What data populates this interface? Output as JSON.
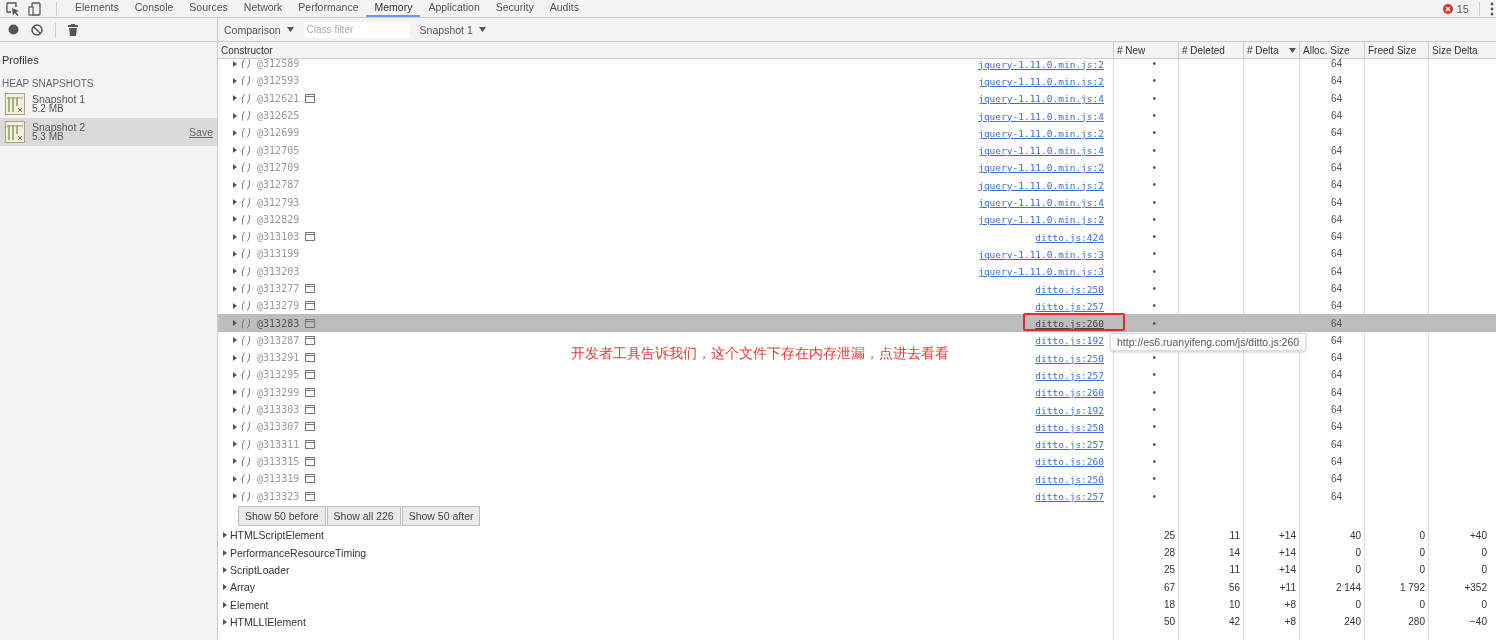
{
  "tabs": [
    {
      "label": "Elements",
      "selected": false
    },
    {
      "label": "Console",
      "selected": false
    },
    {
      "label": "Sources",
      "selected": false
    },
    {
      "label": "Network",
      "selected": false
    },
    {
      "label": "Performance",
      "selected": false
    },
    {
      "label": "Memory",
      "selected": true
    },
    {
      "label": "Application",
      "selected": false
    },
    {
      "label": "Security",
      "selected": false
    },
    {
      "label": "Audits",
      "selected": false
    }
  ],
  "error_count": "15",
  "toolbar": {
    "view": "Comparison",
    "filter_placeholder": "Class filter",
    "baseline": "Snapshot 1"
  },
  "sidebar": {
    "title": "Profiles",
    "section": "HEAP SNAPSHOTS",
    "snapshots": [
      {
        "name": "Snapshot 1",
        "size": "5.2 MB",
        "selected": false
      },
      {
        "name": "Snapshot 2",
        "size": "5.3 MB",
        "selected": true,
        "action": "Save"
      }
    ]
  },
  "table": {
    "columns": [
      {
        "label": "Constructor",
        "sorted": false
      },
      {
        "label": "# New",
        "sorted": false
      },
      {
        "label": "# Deleted",
        "sorted": false
      },
      {
        "label": "# Delta",
        "sorted": true
      },
      {
        "label": "Alloc. Size",
        "sorted": false
      },
      {
        "label": "Freed Size",
        "sorted": false
      },
      {
        "label": "Size Delta",
        "sorted": false
      }
    ],
    "instances": [
      {
        "name": "()",
        "id": "@312589",
        "window_icon": false,
        "source": "jquery-1.11.0.min.js:2",
        "new": "•",
        "alloc": "64",
        "selected": false,
        "boxed": false
      },
      {
        "name": "()",
        "id": "@312593",
        "window_icon": false,
        "source": "jquery-1.11.0.min.js:2",
        "new": "•",
        "alloc": "64",
        "selected": false,
        "boxed": false
      },
      {
        "name": "()",
        "id": "@312621",
        "window_icon": true,
        "source": "jquery-1.11.0.min.js:4",
        "new": "•",
        "alloc": "64",
        "selected": false,
        "boxed": false
      },
      {
        "name": "()",
        "id": "@312625",
        "window_icon": false,
        "source": "jquery-1.11.0.min.js:4",
        "new": "•",
        "alloc": "64",
        "selected": false,
        "boxed": false
      },
      {
        "name": "()",
        "id": "@312699",
        "window_icon": false,
        "source": "jquery-1.11.0.min.js:2",
        "new": "•",
        "alloc": "64",
        "selected": false,
        "boxed": false
      },
      {
        "name": "()",
        "id": "@312705",
        "window_icon": false,
        "source": "jquery-1.11.0.min.js:4",
        "new": "•",
        "alloc": "64",
        "selected": false,
        "boxed": false
      },
      {
        "name": "()",
        "id": "@312709",
        "window_icon": false,
        "source": "jquery-1.11.0.min.js:2",
        "new": "•",
        "alloc": "64",
        "selected": false,
        "boxed": false
      },
      {
        "name": "()",
        "id": "@312787",
        "window_icon": false,
        "source": "jquery-1.11.0.min.js:2",
        "new": "•",
        "alloc": "64",
        "selected": false,
        "boxed": false
      },
      {
        "name": "()",
        "id": "@312793",
        "window_icon": false,
        "source": "jquery-1.11.0.min.js:4",
        "new": "•",
        "alloc": "64",
        "selected": false,
        "boxed": false
      },
      {
        "name": "()",
        "id": "@312829",
        "window_icon": false,
        "source": "jquery-1.11.0.min.js:2",
        "new": "•",
        "alloc": "64",
        "selected": false,
        "boxed": false
      },
      {
        "name": "()",
        "id": "@313103",
        "window_icon": true,
        "source": "ditto.js:424",
        "new": "•",
        "alloc": "64",
        "selected": false,
        "boxed": false
      },
      {
        "name": "()",
        "id": "@313199",
        "window_icon": false,
        "source": "jquery-1.11.0.min.js:3",
        "new": "•",
        "alloc": "64",
        "selected": false,
        "boxed": false
      },
      {
        "name": "()",
        "id": "@313203",
        "window_icon": false,
        "source": "jquery-1.11.0.min.js:3",
        "new": "•",
        "alloc": "64",
        "selected": false,
        "boxed": false
      },
      {
        "name": "()",
        "id": "@313277",
        "window_icon": true,
        "source": "ditto.js:250",
        "new": "•",
        "alloc": "64",
        "selected": false,
        "boxed": false
      },
      {
        "name": "()",
        "id": "@313279",
        "window_icon": true,
        "source": "ditto.js:257",
        "new": "•",
        "alloc": "64",
        "selected": false,
        "boxed": false
      },
      {
        "name": "()",
        "id": "@313283",
        "window_icon": true,
        "source": "ditto.js:260",
        "new": "•",
        "alloc": "64",
        "selected": true,
        "boxed": true
      },
      {
        "name": "()",
        "id": "@313287",
        "window_icon": true,
        "source": "ditto.js:192",
        "alloc": "64",
        "selected": false,
        "boxed": false
      },
      {
        "name": "()",
        "id": "@313291",
        "window_icon": true,
        "source": "ditto.js:250",
        "new": "•",
        "alloc": "64",
        "selected": false,
        "boxed": false
      },
      {
        "name": "()",
        "id": "@313295",
        "window_icon": true,
        "source": "ditto.js:257",
        "new": "•",
        "alloc": "64",
        "selected": false,
        "boxed": false
      },
      {
        "name": "()",
        "id": "@313299",
        "window_icon": true,
        "source": "ditto.js:260",
        "new": "•",
        "alloc": "64",
        "selected": false,
        "boxed": false
      },
      {
        "name": "()",
        "id": "@313303",
        "window_icon": true,
        "source": "ditto.js:192",
        "new": "•",
        "alloc": "64",
        "selected": false,
        "boxed": false
      },
      {
        "name": "()",
        "id": "@313307",
        "window_icon": true,
        "source": "ditto.js:250",
        "new": "•",
        "alloc": "64",
        "selected": false,
        "boxed": false
      },
      {
        "name": "()",
        "id": "@313311",
        "window_icon": true,
        "source": "ditto.js:257",
        "new": "•",
        "alloc": "64",
        "selected": false,
        "boxed": false
      },
      {
        "name": "()",
        "id": "@313315",
        "window_icon": true,
        "source": "ditto.js:260",
        "new": "•",
        "alloc": "64",
        "selected": false,
        "boxed": false
      },
      {
        "name": "()",
        "id": "@313319",
        "window_icon": true,
        "source": "ditto.js:250",
        "new": "•",
        "alloc": "64",
        "selected": false,
        "boxed": false
      },
      {
        "name": "()",
        "id": "@313323",
        "window_icon": true,
        "source": "ditto.js:257",
        "new": "•",
        "alloc": "64",
        "selected": false,
        "boxed": false
      }
    ],
    "paging": [
      "Show 50 before",
      "Show all 226",
      "Show 50 after"
    ],
    "rows": [
      {
        "name": "HTMLScriptElement",
        "cells": [
          "25",
          "11",
          "+14",
          "40",
          "0",
          "+40"
        ]
      },
      {
        "name": "PerformanceResourceTiming",
        "cells": [
          "28",
          "14",
          "+14",
          "0",
          "0",
          "0"
        ]
      },
      {
        "name": "ScriptLoader",
        "cells": [
          "25",
          "11",
          "+14",
          "0",
          "0",
          "0"
        ]
      },
      {
        "name": "Array",
        "cells": [
          "67",
          "56",
          "+11",
          "2 144",
          "1 792",
          "+352"
        ]
      },
      {
        "name": "Element",
        "cells": [
          "18",
          "10",
          "+8",
          "0",
          "0",
          "0"
        ]
      },
      {
        "name": "HTMLLIElement",
        "cells": [
          "50",
          "42",
          "+8",
          "240",
          "280",
          "−40"
        ]
      }
    ]
  },
  "tooltip": "http://es6.ruanyifeng.com/js/ditto.js:260",
  "annotation": {
    "text": "开发者工具告诉我们，这个文件下存在内存泄漏，点进去看看"
  }
}
